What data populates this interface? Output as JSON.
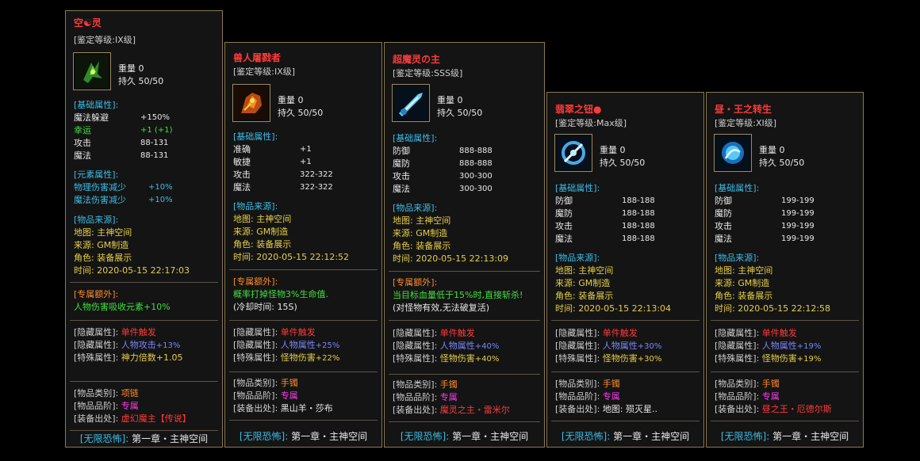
{
  "cards": [
    {
      "title": "空☯灵",
      "title_color": "#ff3a3a",
      "grade": "[鉴定等级:IX级]",
      "icon": "green-claw-icon",
      "weight_label": "重量",
      "weight_value": "0",
      "dur_label": "持久",
      "dur_value": "50/50",
      "base_header": "[基础属性]:",
      "base": [
        {
          "k": "魔法躲避",
          "v": "+150%",
          "color": "white"
        },
        {
          "k": "幸运",
          "v": "+1 (+1)",
          "color": "green"
        },
        {
          "k": "攻击",
          "v": "88-131",
          "color": "white"
        },
        {
          "k": "魔法",
          "v": "88-131",
          "color": "white"
        }
      ],
      "elem_header": "[元素属性]:",
      "elem": [
        {
          "k": "物理伤害减少",
          "v": "+10%"
        },
        {
          "k": "魔法伤害减少",
          "v": "+10%"
        }
      ],
      "source_header": "[物品来源]:",
      "source": [
        "地图: 主神空间",
        "来源: GM制造",
        "角色: 装备展示",
        "时间: 2020-05-15 22:17:03"
      ],
      "extra_header": "[专属额外]:",
      "extra": [
        "人物伤害吸收元素+10%"
      ],
      "extra_color": "green",
      "hidden": [
        {
          "k": "[隐藏属性]:",
          "v": "单件触发",
          "c": "red"
        },
        {
          "k": "[隐藏属性]:",
          "v": "人物攻击",
          "c": "blue",
          "s": "+13%"
        },
        {
          "k": "[特殊属性]:",
          "v": "神力倍数+1.05",
          "c": "yel"
        }
      ],
      "type_label": "[物品类别]:",
      "type_value": "项链",
      "rank_label": "[物品品阶]:",
      "rank_value": "专属",
      "drop_label": "[装备出处]:",
      "drop_value": "虚幻魔主【传说】",
      "drop_color": "red",
      "footer_a": "[无限恐怖]:",
      "footer_b": "第一章・主神空间"
    },
    {
      "title": "兽人屠戮者",
      "title_color": "#ff3a3a",
      "grade": "[鉴定等级:IX级]",
      "icon": "fire-beast-icon",
      "weight_label": "重量",
      "weight_value": "0",
      "dur_label": "持久",
      "dur_value": "50/50",
      "base_header": "[基础属性]:",
      "base": [
        {
          "k": "准确",
          "v": "+1",
          "color": "white"
        },
        {
          "k": "敏捷",
          "v": "+1",
          "color": "white"
        },
        {
          "k": "攻击",
          "v": "322-322",
          "color": "white"
        },
        {
          "k": "魔法",
          "v": "322-322",
          "color": "white"
        }
      ],
      "source_header": "[物品来源]:",
      "source": [
        "地图: 主神空间",
        "来源: GM制造",
        "角色: 装备展示",
        "时间: 2020-05-15 22:12:52"
      ],
      "extra_header": "[专属额外]:",
      "extra": [
        "概率打掉怪物3%生命值.",
        "(冷却时间: 15S)"
      ],
      "extra_color": "green",
      "hidden": [
        {
          "k": "[隐藏属性]:",
          "v": "单件触发",
          "c": "red"
        },
        {
          "k": "[隐藏属性]:",
          "v": "人物属性",
          "c": "blue",
          "s": "+25%"
        },
        {
          "k": "[特殊属性]:",
          "v": "怪物伤害",
          "c": "yel",
          "s": "+22%"
        }
      ],
      "type_label": "[物品类别]:",
      "type_value": "手镯",
      "rank_label": "[物品品阶]:",
      "rank_value": "专属",
      "drop_label": "[装备出处]:",
      "drop_value": "黑山羊・莎布",
      "drop_color": "white",
      "footer_a": "[无限恐怖]:",
      "footer_b": "第一章・主神空间"
    },
    {
      "title": "超魔灵の主",
      "title_color": "#ff3a3a",
      "grade": "[鉴定等级:SSS级]",
      "icon": "ice-blade-icon",
      "weight_label": "重量",
      "weight_value": "0",
      "dur_label": "持久",
      "dur_value": "50/50",
      "base_header": "[基础属性]:",
      "base": [
        {
          "k": "防御",
          "v": "888-888",
          "color": "white"
        },
        {
          "k": "魔防",
          "v": "888-888",
          "color": "white"
        },
        {
          "k": "攻击",
          "v": "300-300",
          "color": "white"
        },
        {
          "k": "魔法",
          "v": "300-300",
          "color": "white"
        }
      ],
      "source_header": "[物品来源]:",
      "source": [
        "地图: 主神空间",
        "来源: GM制造",
        "角色: 装备展示",
        "时间: 2020-05-15 22:13:09"
      ],
      "extra_header": "[专属额外]:",
      "extra": [
        "当目标血量低于15%时,直接斩杀!",
        "(对怪物有效,无法破复活)"
      ],
      "extra_color": "green",
      "hidden": [
        {
          "k": "[隐藏属性]:",
          "v": "单件触发",
          "c": "red"
        },
        {
          "k": "[隐藏属性]:",
          "v": "人物属性",
          "c": "blue",
          "s": "+40%"
        },
        {
          "k": "[特殊属性]:",
          "v": "怪物伤害",
          "c": "yel",
          "s": "+40%"
        }
      ],
      "type_label": "[物品类别]:",
      "type_value": "手镯",
      "rank_label": "[物品品阶]:",
      "rank_value": "专属",
      "drop_label": "[装备出处]:",
      "drop_value": "魔灵之主・雷米尔",
      "drop_color": "red",
      "footer_a": "[无限恐怖]:",
      "footer_b": "第一章・主神空间"
    },
    {
      "title": "翡翠之钮●",
      "title_color": "#ff3a3a",
      "grade": "[鉴定等级:Max级]",
      "icon": "frost-ring-icon",
      "weight_label": "重量",
      "weight_value": "0",
      "dur_label": "持久",
      "dur_value": "50/50",
      "base_header": "[基础属性]:",
      "base": [
        {
          "k": "防御",
          "v": "188-188",
          "color": "white"
        },
        {
          "k": "魔防",
          "v": "188-188",
          "color": "white"
        },
        {
          "k": "攻击",
          "v": "188-188",
          "color": "white"
        },
        {
          "k": "魔法",
          "v": "188-188",
          "color": "white"
        }
      ],
      "source_header": "[物品来源]:",
      "source": [
        "地图: 主神空间",
        "来源: GM制造",
        "角色: 装备展示",
        "时间: 2020-05-15 22:13:04"
      ],
      "hidden": [
        {
          "k": "[隐藏属性]:",
          "v": "单件触发",
          "c": "red"
        },
        {
          "k": "[隐藏属性]:",
          "v": "人物属性",
          "c": "blue",
          "s": "+30%"
        },
        {
          "k": "[特殊属性]:",
          "v": "怪物伤害",
          "c": "yel",
          "s": "+30%"
        }
      ],
      "type_label": "[物品类别]:",
      "type_value": "手镯",
      "rank_label": "[物品品阶]:",
      "rank_value": "专属",
      "drop_label": "[装备出处]:",
      "drop_value": "地图: 殒灭星..",
      "drop_color": "white",
      "footer_a": "[无限恐怖]:",
      "footer_b": "第一章・主神空间"
    },
    {
      "title": "昼・王之转生",
      "title_color": "#ff3a3a",
      "grade": "[鉴定等级:XI级]",
      "icon": "blue-orb-icon",
      "weight_label": "重量",
      "weight_value": "0",
      "dur_label": "持久",
      "dur_value": "50/50",
      "base_header": "[基础属性]:",
      "base": [
        {
          "k": "防御",
          "v": "199-199",
          "color": "white"
        },
        {
          "k": "魔防",
          "v": "199-199",
          "color": "white"
        },
        {
          "k": "攻击",
          "v": "199-199",
          "color": "white"
        },
        {
          "k": "魔法",
          "v": "199-199",
          "color": "white"
        }
      ],
      "source_header": "[物品来源]:",
      "source": [
        "地图: 主神空间",
        "来源: GM制造",
        "角色: 装备展示",
        "时间: 2020-05-15 22:12:58"
      ],
      "hidden": [
        {
          "k": "[隐藏属性]:",
          "v": "单件触发",
          "c": "red"
        },
        {
          "k": "[隐藏属性]:",
          "v": "人物属性",
          "c": "blue",
          "s": "+19%"
        },
        {
          "k": "[特殊属性]:",
          "v": "怪物伤害",
          "c": "yel",
          "s": "+19%"
        }
      ],
      "type_label": "[物品类别]:",
      "type_value": "手镯",
      "rank_label": "[物品品阶]:",
      "rank_value": "专属",
      "drop_label": "[装备出处]:",
      "drop_value": "昼之王・厄德尔斯",
      "drop_color": "red",
      "footer_a": "[无限恐怖]:",
      "footer_b": "第一章・主神空间"
    }
  ]
}
